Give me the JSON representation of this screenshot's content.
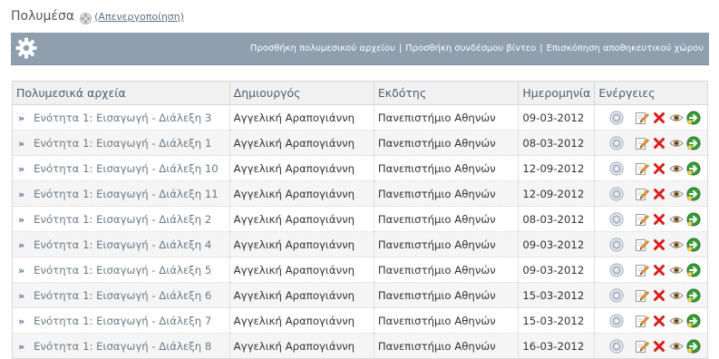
{
  "header": {
    "title": "Πολυμέσα",
    "deactivate_label": "(Απενεργοποίηση)"
  },
  "toolbar": {
    "links": [
      {
        "label": "Προσθήκη πολυμεσικού αρχείου"
      },
      {
        "label": "Προσθήκη συνδέσμου βίντεο"
      },
      {
        "label": "Επισκόπηση αποθηκευτικού χώρου"
      }
    ],
    "separator": "|"
  },
  "table": {
    "columns": [
      "Πολυμεσικά αρχεία",
      "Δημιουργός",
      "Εκδότης",
      "Ημερομηνία",
      "Ενέργειες"
    ],
    "arrow": "»",
    "rows": [
      {
        "title": "Ενότητα 1: Εισαγωγή - Διάλεξη 3",
        "creator": "Αγγελική Αραπογιάννη",
        "publisher": "Πανεπιστήμιο Αθηνών",
        "date": "09-03-2012"
      },
      {
        "title": "Ενότητα 1: Εισαγωγή - Διάλεξη 1",
        "creator": "Αγγελική Αραπογιάννη",
        "publisher": "Πανεπιστήμιο Αθηνών",
        "date": "08-03-2012"
      },
      {
        "title": "Ενότητα 1: Εισαγωγή - Διάλεξη 10",
        "creator": "Αγγελική Αραπογιάννη",
        "publisher": "Πανεπιστήμιο Αθηνών",
        "date": "12-09-2012"
      },
      {
        "title": "Ενότητα 1: Εισαγωγή - Διάλεξη 11",
        "creator": "Αγγελική Αραπογιάννη",
        "publisher": "Πανεπιστήμιο Αθηνών",
        "date": "12-09-2012"
      },
      {
        "title": "Ενότητα 1: Εισαγωγή - Διάλεξη 2",
        "creator": "Αγγελική Αραπογιάννη",
        "publisher": "Πανεπιστήμιο Αθηνών",
        "date": "08-03-2012"
      },
      {
        "title": "Ενότητα 1: Εισαγωγή - Διάλεξη 4",
        "creator": "Αγγελική Αραπογιάννη",
        "publisher": "Πανεπιστήμιο Αθηνών",
        "date": "09-03-2012"
      },
      {
        "title": "Ενότητα 1: Εισαγωγή - Διάλεξη 5",
        "creator": "Αγγελική Αραπογιάννη",
        "publisher": "Πανεπιστήμιο Αθηνών",
        "date": "09-03-2012"
      },
      {
        "title": "Ενότητα 1: Εισαγωγή - Διάλεξη 6",
        "creator": "Αγγελική Αραπογιάννη",
        "publisher": "Πανεπιστήμιο Αθηνών",
        "date": "15-03-2012"
      },
      {
        "title": "Ενότητα 1: Εισαγωγή - Διάλεξη 7",
        "creator": "Αγγελική Αραπογιάννη",
        "publisher": "Πανεπιστήμιο Αθηνών",
        "date": "15-03-2012"
      },
      {
        "title": "Ενότητα 1: Εισαγωγή - Διάλεξη 8",
        "creator": "Αγγελική Αραπογιάννη",
        "publisher": "Πανεπιστήμιο Αθηνών",
        "date": "16-03-2012"
      }
    ],
    "action_icons": [
      "properties-icon",
      "edit-icon",
      "delete-icon",
      "visibility-icon",
      "move-icon"
    ]
  },
  "colors": {
    "toolbar_bg": "#8f9fae",
    "header_text": "#4b6176",
    "link": "#5a6f88"
  }
}
